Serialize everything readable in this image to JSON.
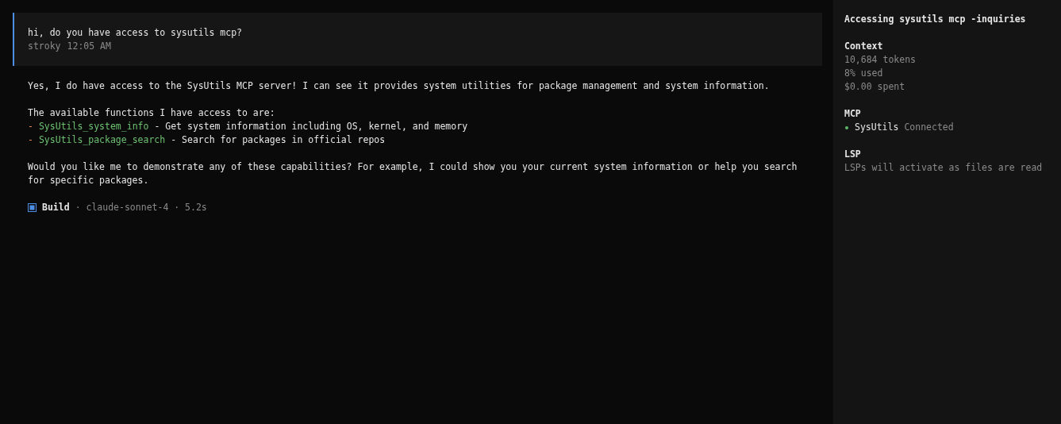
{
  "user_message": {
    "text": "hi, do you have access to sysutils mcp?",
    "author": "stroky",
    "time": "12:05 AM"
  },
  "assistant_message": {
    "intro": "Yes, I do have access to the SysUtils MCP server! I can see it provides system utilities for package management and system information.",
    "list_heading": "The available functions I have access to are:",
    "functions": [
      {
        "marker": "-",
        "name": "SysUtils_system_info",
        "description": "- Get system information including OS, kernel, and memory"
      },
      {
        "marker": "-",
        "name": "SysUtils_package_search",
        "description": "- Search for packages in official repos"
      }
    ],
    "closing": "Would you like me to demonstrate any of these capabilities? For example, I could show you your current system information or help you search for specific packages.",
    "footer": {
      "agent": "Build",
      "details": "· claude-sonnet-4 · 5.2s"
    }
  },
  "sidebar": {
    "title": "Accessing sysutils mcp -inquiries",
    "context": {
      "heading": "Context",
      "lines": [
        "10,684 tokens",
        "8% used",
        "$0.00 spent"
      ]
    },
    "mcp": {
      "heading": "MCP",
      "servers": [
        {
          "name": "SysUtils",
          "status": "Connected",
          "color": "#5fb96b"
        }
      ]
    },
    "lsp": {
      "heading": "LSP",
      "note": "LSPs will activate as files are read"
    }
  }
}
